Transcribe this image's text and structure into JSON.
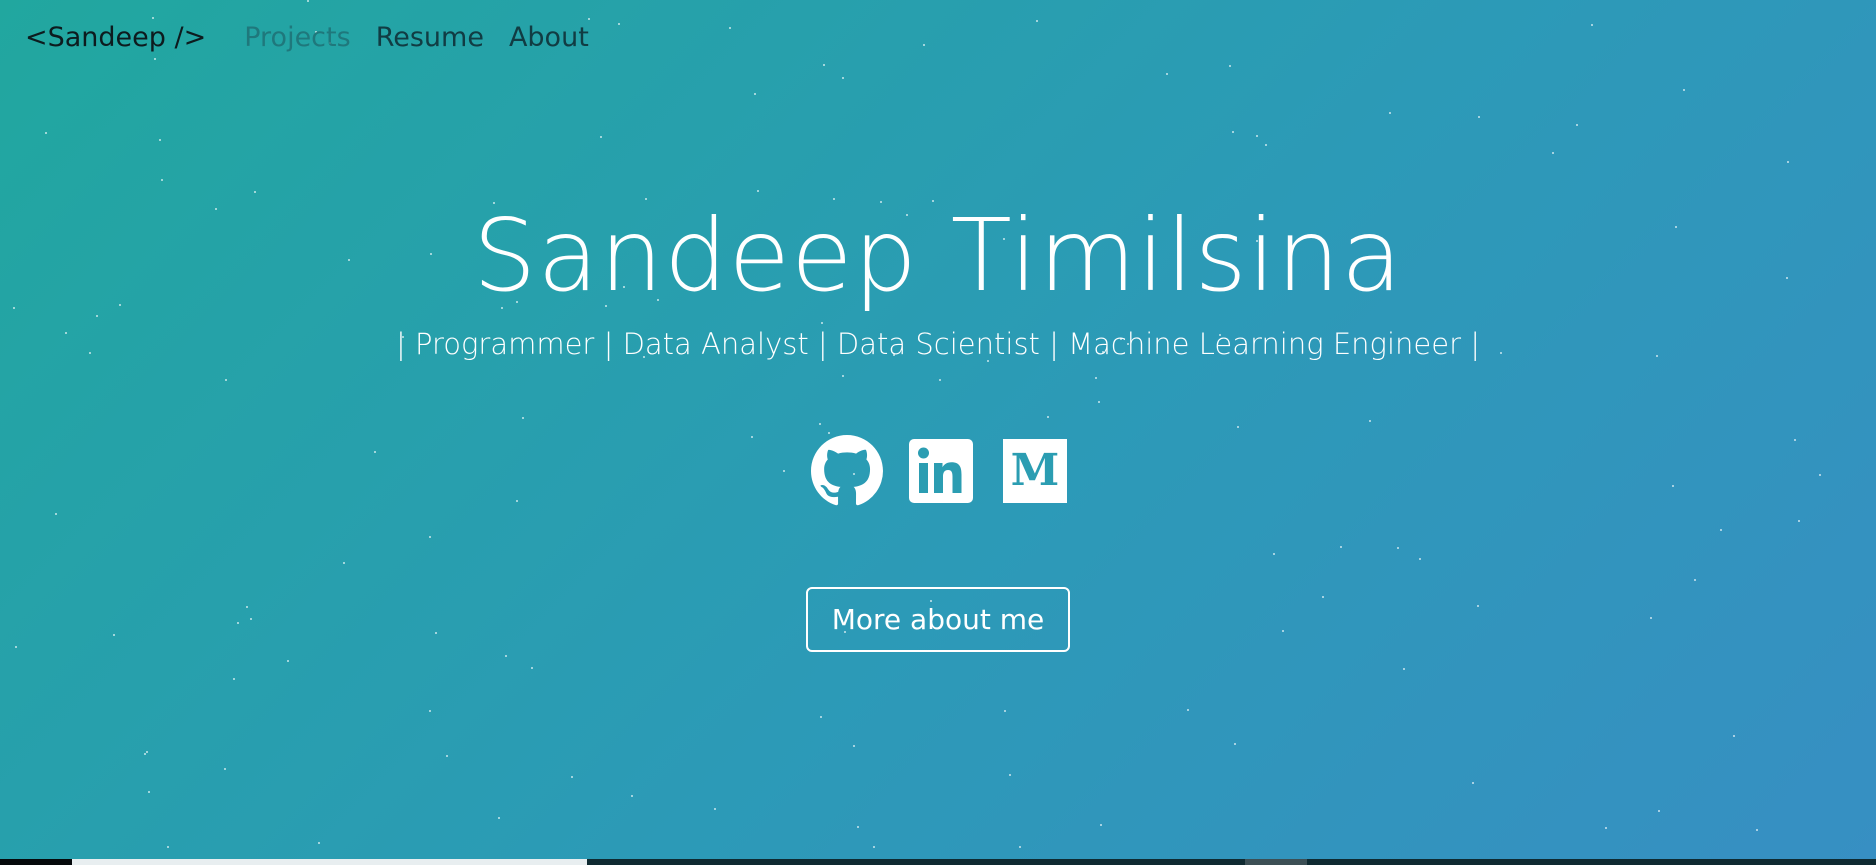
{
  "nav": {
    "brand": "<Sandeep />",
    "links": [
      "Projects",
      "Resume",
      "About"
    ]
  },
  "hero": {
    "title": "Sandeep Timilsina",
    "subtitle": "| Programmer | Data Analyst | Data Scientist | Machine Learning Engineer |"
  },
  "social": {
    "icons": [
      "github-icon",
      "linkedin-icon",
      "medium-icon"
    ]
  },
  "cta": {
    "label": "More about me"
  },
  "colors": {
    "gradient_start": "#21a79f",
    "gradient_end": "#378fc3",
    "brand_text": "#0d1b1e",
    "nav_text": "#113c43",
    "text": "#ffffff"
  }
}
